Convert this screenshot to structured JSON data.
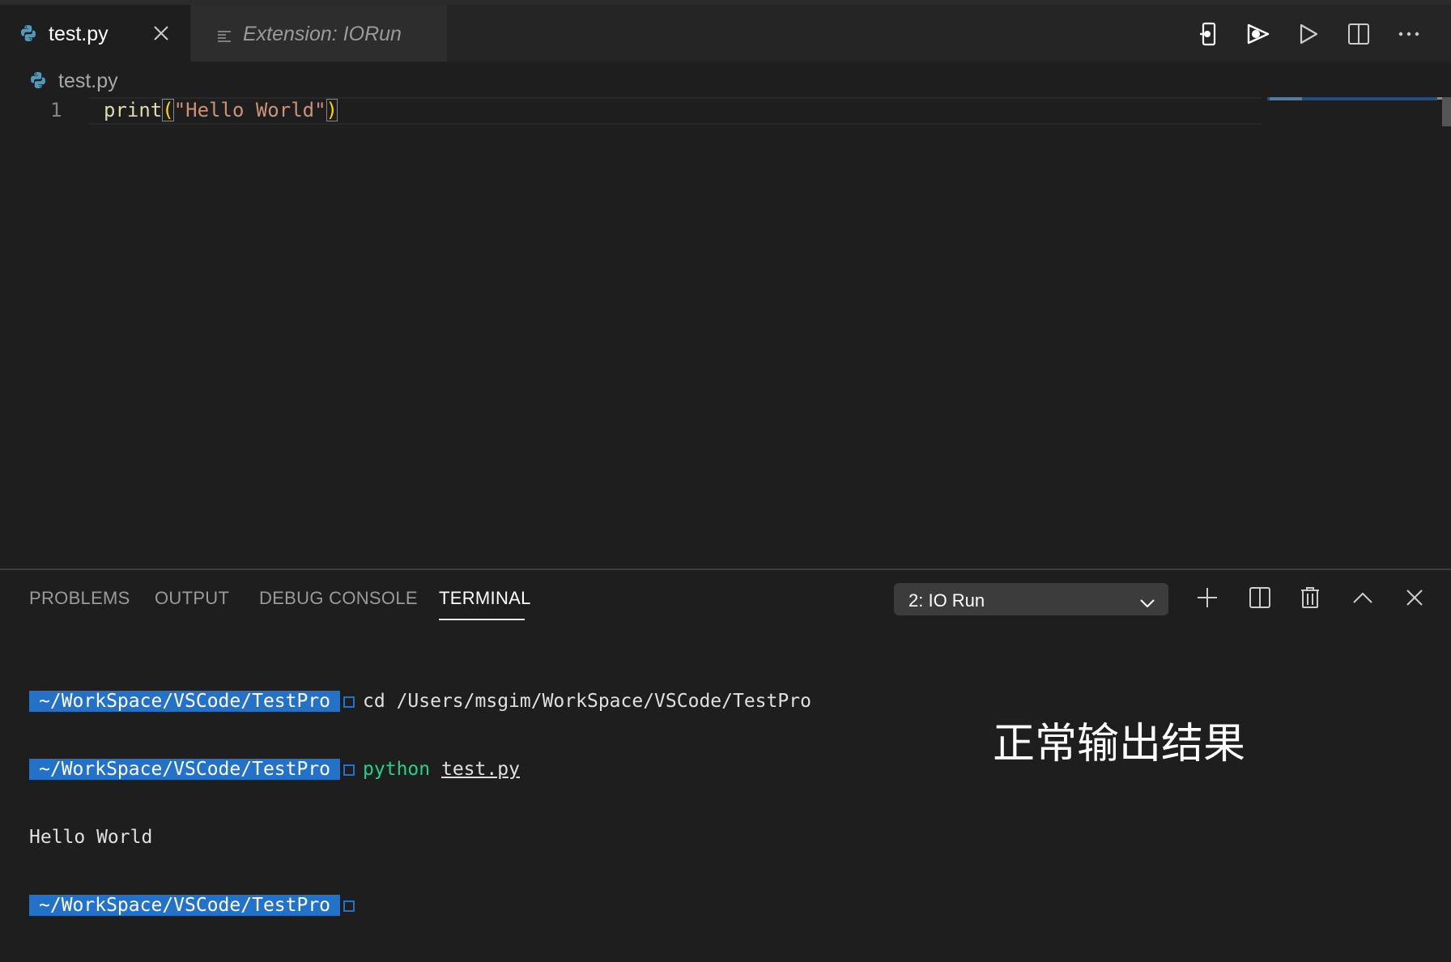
{
  "tabs": [
    {
      "label": "test.py",
      "active": true,
      "icon": "python-icon"
    },
    {
      "label": "Extension: IORun",
      "active": false,
      "icon": "preview-icon"
    }
  ],
  "editor_actions": [
    "debug-device-icon",
    "run-io-icon",
    "run-icon",
    "split-editor-icon",
    "more-icon"
  ],
  "breadcrumb": {
    "file": "test.py"
  },
  "editor": {
    "line_number": "1",
    "code": {
      "fn": "print",
      "open": "(",
      "str": "\"Hello World\"",
      "close": ")"
    }
  },
  "panel": {
    "tabs": [
      "PROBLEMS",
      "OUTPUT",
      "DEBUG CONSOLE",
      "TERMINAL"
    ],
    "active_tab": "TERMINAL",
    "terminal_select": "2: IO Run"
  },
  "terminal": {
    "prompt": "~/WorkSpace/VSCode/TestPro",
    "line1_cmd": "cd /Users/msgim/WorkSpace/VSCode/TestPro",
    "line2_cmd": "python",
    "line2_arg": "test.py",
    "output": "Hello World"
  },
  "caption": "正常输出结果",
  "colors": {
    "accent": "#2472c8",
    "string": "#ce9178",
    "function": "#dcdcaa",
    "bracket": "#ffd700",
    "terminal_green": "#23d18b"
  }
}
